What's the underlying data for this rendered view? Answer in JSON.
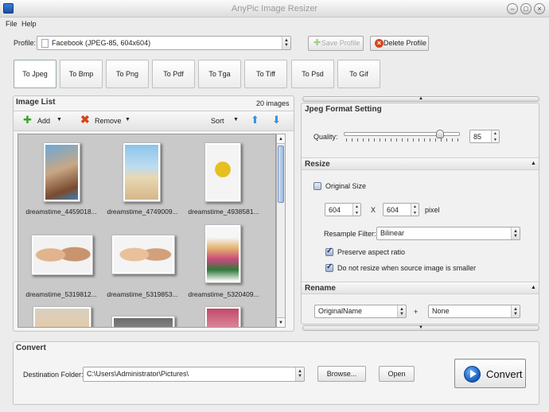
{
  "window": {
    "title": "AnyPic Image Resizer"
  },
  "menu": [
    "File",
    "Help"
  ],
  "profile": {
    "label": "Profile:",
    "value": "Facebook (JPEG-85, 604x604)",
    "save_label": "Save Profile",
    "delete_label": "Delete Profile"
  },
  "tabs": [
    "To Jpeg",
    "To Bmp",
    "To Png",
    "To Pdf",
    "To Tga",
    "To Tiff",
    "To Psd",
    "To Gif"
  ],
  "image_list": {
    "title": "Image List",
    "count": "20 images",
    "add_label": "Add",
    "remove_label": "Remove",
    "sort_label": "Sort",
    "files": [
      "dreamstime_4459018...",
      "dreamstime_4749009...",
      "dreamstime_4938581...",
      "dreamstime_5319812...",
      "dreamstime_5319853...",
      "dreamstime_5320409..."
    ]
  },
  "jpeg_setting": {
    "title": "Jpeg Format Setting",
    "quality_label": "Quality:",
    "quality_value": "85",
    "quality_fraction": 0.85
  },
  "resize": {
    "title": "Resize",
    "original_size_label": "Original Size",
    "width": "604",
    "x_label": "X",
    "height": "604",
    "unit_label": "pixel",
    "filter_label": "Resample Filter:",
    "filter_value": "Bilinear",
    "preserve_label": "Preserve aspect ratio",
    "no_upscale_label": "Do not resize when source image is smaller"
  },
  "rename": {
    "title": "Rename",
    "first_value": "OriginalName",
    "plus": "+",
    "second_value": "None"
  },
  "convert": {
    "title": "Convert",
    "dest_label": "Destination Folder:",
    "dest_value": "C:\\Users\\Administrator\\Pictures\\",
    "browse_label": "Browse...",
    "open_label": "Open",
    "convert_label": "Convert"
  },
  "colors": {
    "accent": "#1b66c9",
    "delete": "#d6461c",
    "add": "#3aa52a"
  }
}
